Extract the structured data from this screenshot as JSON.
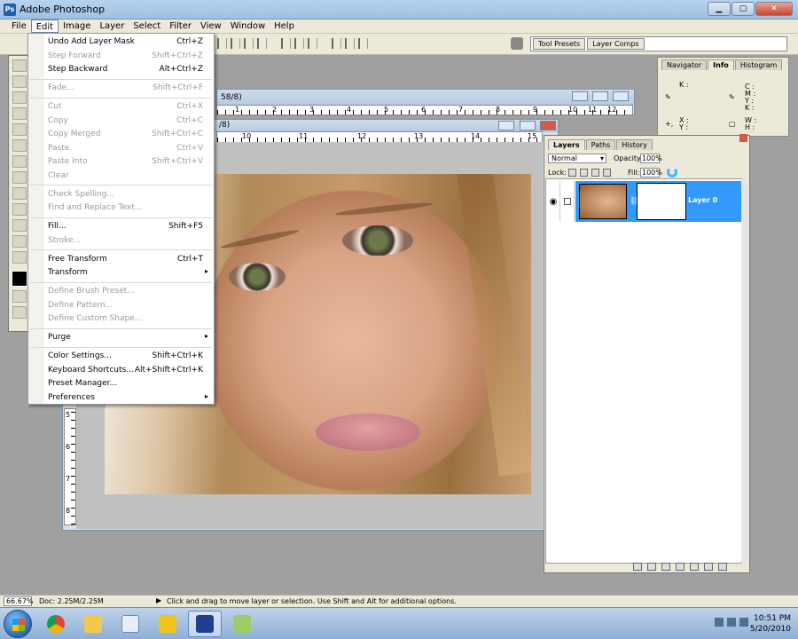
{
  "window": {
    "title": "Adobe Photoshop",
    "icon_text": "Ps"
  },
  "menubar": {
    "items": [
      "File",
      "Edit",
      "Image",
      "Layer",
      "Select",
      "Filter",
      "View",
      "Window",
      "Help"
    ],
    "active": "Edit"
  },
  "palette_well": {
    "tabs": [
      "Tool Presets",
      "Layer Comps"
    ]
  },
  "edit_menu": {
    "items": [
      {
        "label": "Undo Add Layer Mask",
        "shortcut": "Ctrl+Z",
        "enabled": true
      },
      {
        "label": "Step Forward",
        "shortcut": "Shift+Ctrl+Z",
        "enabled": false
      },
      {
        "label": "Step Backward",
        "shortcut": "Alt+Ctrl+Z",
        "enabled": true
      },
      {
        "label": "Fade...",
        "shortcut": "Shift+Ctrl+F",
        "enabled": false
      },
      {
        "label": "Cut",
        "shortcut": "Ctrl+X",
        "enabled": false
      },
      {
        "label": "Copy",
        "shortcut": "Ctrl+C",
        "enabled": false
      },
      {
        "label": "Copy Merged",
        "shortcut": "Shift+Ctrl+C",
        "enabled": false
      },
      {
        "label": "Paste",
        "shortcut": "Ctrl+V",
        "enabled": false
      },
      {
        "label": "Paste Into",
        "shortcut": "Shift+Ctrl+V",
        "enabled": false
      },
      {
        "label": "Clear",
        "shortcut": "",
        "enabled": false
      },
      {
        "label": "Check Spelling...",
        "shortcut": "",
        "enabled": false
      },
      {
        "label": "Find and Replace Text...",
        "shortcut": "",
        "enabled": false
      },
      {
        "label": "Fill...",
        "shortcut": "Shift+F5",
        "enabled": true
      },
      {
        "label": "Stroke...",
        "shortcut": "",
        "enabled": false
      },
      {
        "label": "Free Transform",
        "shortcut": "Ctrl+T",
        "enabled": true
      },
      {
        "label": "Transform",
        "shortcut": "",
        "enabled": true,
        "submenu": true
      },
      {
        "label": "Define Brush Preset...",
        "shortcut": "",
        "enabled": false
      },
      {
        "label": "Define Pattern...",
        "shortcut": "",
        "enabled": false
      },
      {
        "label": "Define Custom Shape...",
        "shortcut": "",
        "enabled": false
      },
      {
        "label": "Purge",
        "shortcut": "",
        "enabled": true,
        "submenu": true
      },
      {
        "label": "Color Settings...",
        "shortcut": "Shift+Ctrl+K",
        "enabled": true
      },
      {
        "label": "Keyboard Shortcuts...",
        "shortcut": "Alt+Shift+Ctrl+K",
        "enabled": true
      },
      {
        "label": "Preset Manager...",
        "shortcut": "",
        "enabled": true
      },
      {
        "label": "Preferences",
        "shortcut": "",
        "enabled": true,
        "submenu": true
      }
    ]
  },
  "document_back": {
    "title_fragment": "58/8)"
  },
  "document_front": {
    "title_fragment": "/8)"
  },
  "rulers": {
    "top_back": [
      "1",
      "2",
      "3",
      "4",
      "5",
      "6",
      "7",
      "8",
      "9",
      "10",
      "11",
      "12"
    ],
    "top_front": [
      "10",
      "11",
      "12",
      "13",
      "14",
      "15"
    ],
    "left": [
      "5",
      "6",
      "7",
      "8"
    ]
  },
  "navigator": {
    "tabs": [
      "Navigator",
      "Info",
      "Histogram"
    ],
    "active_tab": "Info",
    "labels": {
      "k1": "K :",
      "c": "C :",
      "m": "M :",
      "y": "Y :",
      "k2": "K :",
      "x": "X :",
      "yy": "Y :",
      "w": "W :",
      "h": "H :",
      "plus": "+,"
    }
  },
  "layers_panel": {
    "tabs": [
      "Layers",
      "Paths",
      "History"
    ],
    "active_tab": "Layers",
    "blend_mode": "Normal",
    "opacity_label": "Opacity:",
    "opacity": "100%",
    "lock_label": "Lock:",
    "fill_label": "Fill:",
    "fill": "100%",
    "layers": [
      {
        "name": "Layer 0",
        "selected": true
      }
    ]
  },
  "statusbar": {
    "zoom": "66.67%",
    "doc": "Doc: 2.25M/2.25M",
    "hint": "Click and drag to move layer or selection.  Use Shift and Alt for additional options."
  },
  "taskbar": {
    "time": "10:51 PM",
    "date": "5/20/2010"
  },
  "colors": {
    "accent": "#3399ff",
    "menubar_bg": "#ece9d8",
    "workspace": "#a0a0a0",
    "taskbar": "#8eb0d6"
  }
}
